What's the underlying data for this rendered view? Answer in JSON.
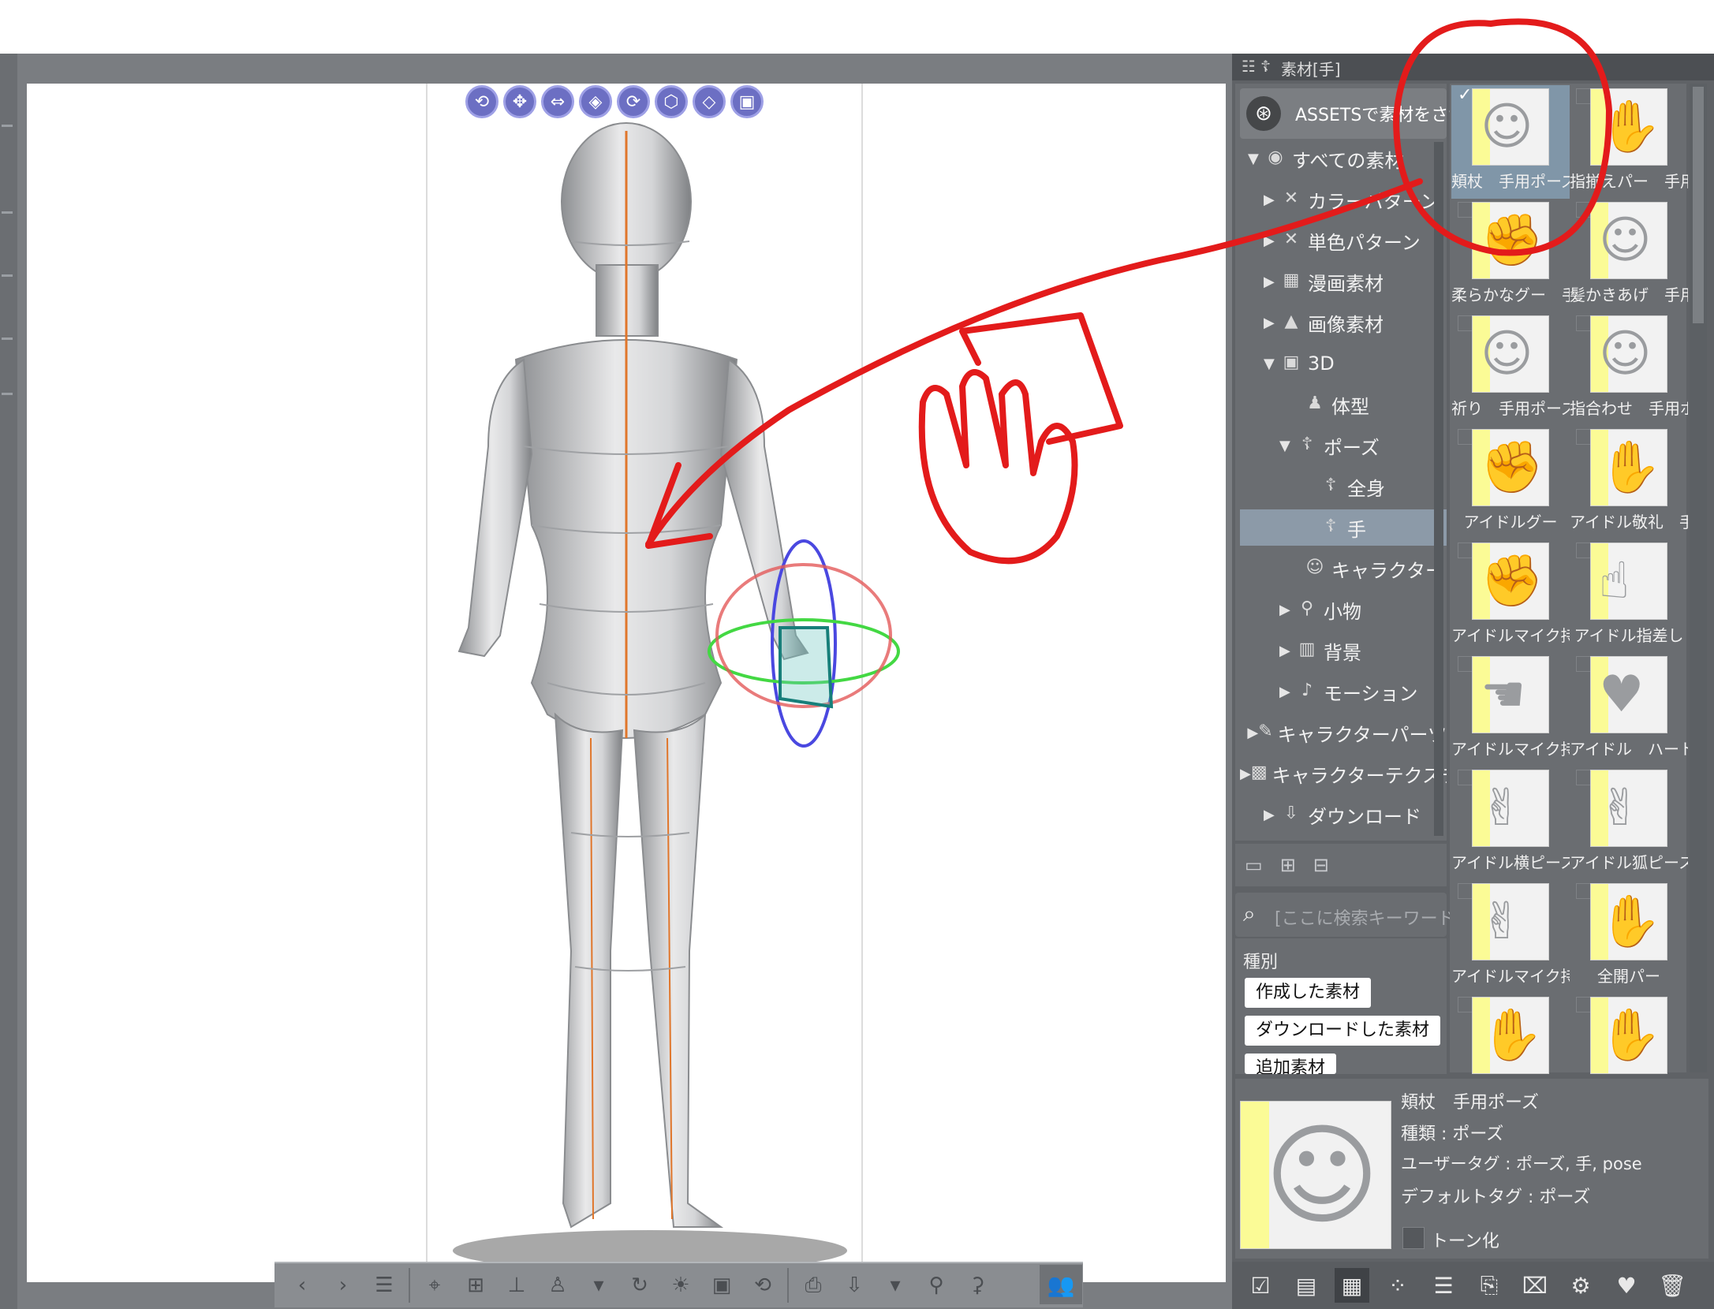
{
  "panel": {
    "tab_title": "素材[手]",
    "assets_label": "ASSETSで素材をさがす",
    "tree": [
      {
        "label": "すべての素材",
        "icon": "circle-icon",
        "expanded": true
      },
      {
        "label": "カラーパターン",
        "icon": "color-pattern-icon",
        "expanded": false
      },
      {
        "label": "単色パターン",
        "icon": "mono-pattern-icon",
        "expanded": false
      },
      {
        "label": "漫画素材",
        "icon": "manga-icon",
        "expanded": false
      },
      {
        "label": "画像素材",
        "icon": "image-icon",
        "expanded": false
      },
      {
        "label": "3D",
        "icon": "cube-icon",
        "expanded": true
      },
      {
        "label": "体型",
        "icon": "body-type-icon",
        "expanded": null
      },
      {
        "label": "ポーズ",
        "icon": "pose-icon",
        "expanded": true
      },
      {
        "label": "全身",
        "icon": "pose-icon",
        "expanded": null
      },
      {
        "label": "手",
        "icon": "pose-icon",
        "expanded": null,
        "selected": true
      },
      {
        "label": "キャラクター",
        "icon": "character-icon",
        "expanded": null
      },
      {
        "label": "小物",
        "icon": "prop-icon",
        "expanded": false
      },
      {
        "label": "背景",
        "icon": "background-icon",
        "expanded": false
      },
      {
        "label": "モーション",
        "icon": "motion-icon",
        "expanded": false
      },
      {
        "label": "キャラクターパーツ",
        "icon": "character-parts-icon",
        "expanded": false
      },
      {
        "label": "キャラクターテクスチャ",
        "icon": "texture-icon",
        "expanded": false
      },
      {
        "label": "ダウンロード",
        "icon": "download-icon",
        "expanded": false
      }
    ],
    "search_placeholder": "[ここに検索キーワード...",
    "filter_heading": "種別",
    "filter_chips": [
      "作成した素材",
      "ダウンロードした素材",
      "追加素材"
    ],
    "materials": [
      {
        "caption": "頬杖　手用ポーズ",
        "selected": true,
        "glyph": "☺"
      },
      {
        "caption": "指揃えパー　手用",
        "selected": false,
        "glyph": "✋"
      },
      {
        "caption": "柔らかなグー　手用",
        "selected": false,
        "glyph": "✊"
      },
      {
        "caption": "髪かきあげ　手用",
        "selected": false,
        "glyph": "☺"
      },
      {
        "caption": "祈り　手用ポーズ",
        "selected": false,
        "glyph": "☺"
      },
      {
        "caption": "指合わせ　手用ポ",
        "selected": false,
        "glyph": "☺"
      },
      {
        "caption": "アイドルグー",
        "selected": false,
        "glyph": "✊"
      },
      {
        "caption": "アイドル敬礼　手用",
        "selected": false,
        "glyph": "✋"
      },
      {
        "caption": "アイドルマイク持ち",
        "selected": false,
        "glyph": "✊"
      },
      {
        "caption": "アイドル指差し",
        "selected": false,
        "glyph": "☝"
      },
      {
        "caption": "アイドルマイク持ち",
        "selected": false,
        "glyph": "☚"
      },
      {
        "caption": "アイドル　ハート用",
        "selected": false,
        "glyph": "♥"
      },
      {
        "caption": "アイドル横ピース",
        "selected": false,
        "glyph": "✌"
      },
      {
        "caption": "アイドル狐ピース",
        "selected": false,
        "glyph": "✌"
      },
      {
        "caption": "アイドルマイク持ち",
        "selected": false,
        "glyph": "✌"
      },
      {
        "caption": "全開パー",
        "selected": false,
        "glyph": "✋"
      },
      {
        "caption": "",
        "selected": false,
        "glyph": "✋"
      },
      {
        "caption": "",
        "selected": false,
        "glyph": "✋"
      }
    ],
    "detail": {
      "name": "頬杖　手用ポーズ",
      "type_line": "種類 : ポーズ",
      "user_tags": "ユーザータグ : ポーズ, 手, pose",
      "default_tags": "デフォルトタグ : ポーズ",
      "tone_label": "トーン化"
    }
  },
  "annotation_color": "#e31b1b",
  "accent_colors": {
    "gizmo_blue": "#4a48e0",
    "gizmo_red": "#e45a5a",
    "gizmo_green": "#43d843",
    "spine": "#e0762b",
    "selection": "#8096a8"
  }
}
